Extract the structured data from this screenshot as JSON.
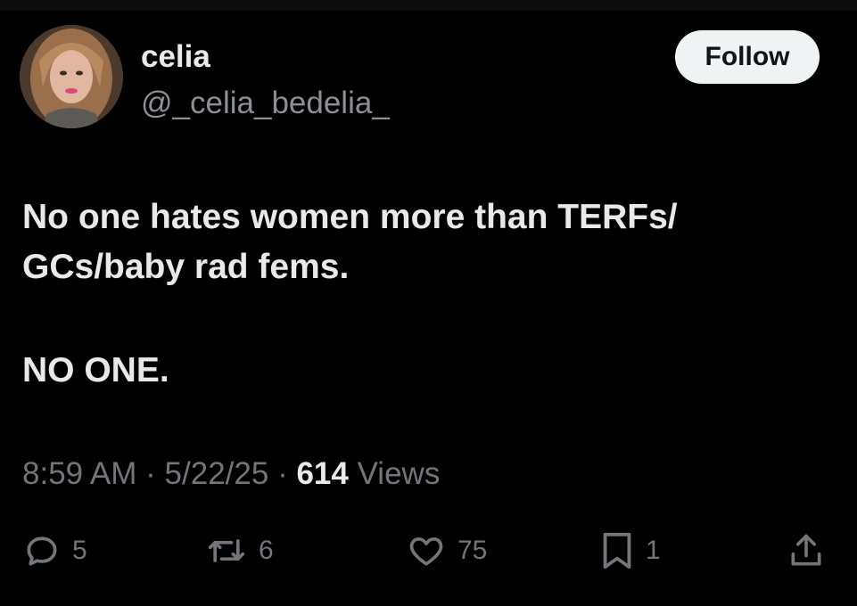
{
  "user": {
    "display_name": "celia",
    "handle": "@_celia_bedelia_",
    "follow_label": "Follow"
  },
  "tweet": {
    "lines": [
      "No one hates women more than TERFs/",
      "GCs/baby rad fems.",
      "NO ONE."
    ],
    "time": "8:59 AM",
    "date": "5/22/25",
    "views_count": "614",
    "views_label": "Views",
    "separator": "·"
  },
  "actions": {
    "replies": "5",
    "reposts": "6",
    "likes": "75",
    "bookmarks": "1"
  },
  "icons": {
    "reply": "reply-icon",
    "repost": "repost-icon",
    "like": "heart-icon",
    "bookmark": "bookmark-icon",
    "share": "share-icon"
  },
  "colors": {
    "background": "#000000",
    "primary_text": "#e7e9ea",
    "secondary_text": "#71767b",
    "follow_bg": "#eff3f4"
  }
}
